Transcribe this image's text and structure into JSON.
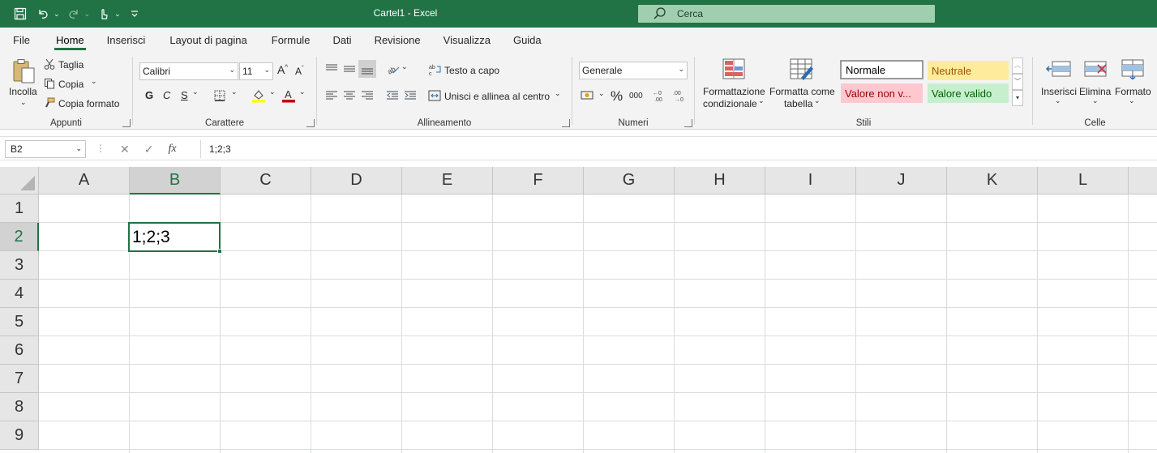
{
  "window": {
    "title": "Cartel1  -  Excel",
    "search_placeholder": "Cerca"
  },
  "tabs": [
    "File",
    "Home",
    "Inserisci",
    "Layout di pagina",
    "Formule",
    "Dati",
    "Revisione",
    "Visualizza",
    "Guida"
  ],
  "active_tab": "Home",
  "ribbon": {
    "clipboard": {
      "paste": "Incolla",
      "cut": "Taglia",
      "copy": "Copia",
      "format_painter": "Copia formato",
      "label": "Appunti"
    },
    "font": {
      "name": "Calibri",
      "size": "11",
      "bold": "G",
      "italic": "C",
      "underline": "S",
      "label": "Carattere"
    },
    "alignment": {
      "wrap_text": "Testo a capo",
      "merge_center": "Unisci e allinea al centro",
      "label": "Allineamento"
    },
    "number": {
      "format": "Generale",
      "label": "Numeri"
    },
    "styles": {
      "conditional_formatting": [
        "Formattazione",
        "condizionale"
      ],
      "format_as_table": [
        "Formatta come",
        "tabella"
      ],
      "cells": [
        "Normale",
        "Neutrale",
        "Valore non v...",
        "Valore valido"
      ],
      "label": "Stili"
    },
    "cells": {
      "insert": "Inserisci",
      "delete": "Elimina",
      "format": "Formato",
      "label": "Celle"
    }
  },
  "formula_bar": {
    "name_box": "B2",
    "fx": "fx",
    "content": "1;2;3"
  },
  "sheet": {
    "columns": [
      "A",
      "B",
      "C",
      "D",
      "E",
      "F",
      "G",
      "H",
      "I",
      "J",
      "K",
      "L"
    ],
    "rows": [
      "1",
      "2",
      "3",
      "4",
      "5",
      "6",
      "7",
      "8",
      "9"
    ],
    "selected_column": "B",
    "selected_row": "2",
    "selected_value": "1;2;3"
  },
  "colors": {
    "accent": "#217346",
    "neutral_bg": "#ffeb9c",
    "bad_bg": "#ffc7ce",
    "good_bg": "#c6efce"
  }
}
